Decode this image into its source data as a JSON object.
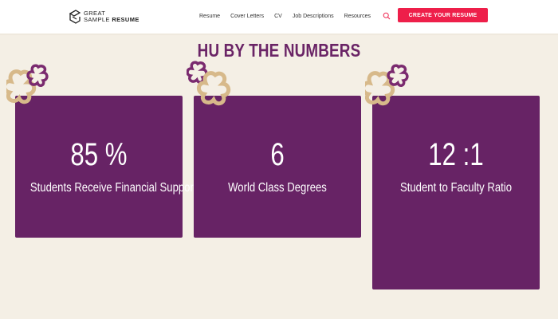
{
  "header": {
    "logo": {
      "line1": "GREAT",
      "line2_a": "SAMPLE ",
      "line2_b": "RESUME"
    },
    "nav": [
      "Resume",
      "Cover Letters",
      "CV",
      "Job Descriptions",
      "Resources"
    ],
    "search_icon": "search-icon",
    "cta_label": "CREATE YOUR RESUME"
  },
  "section": {
    "title": "HU BY THE NUMBERS"
  },
  "stats": [
    {
      "value": "85 %",
      "label": "Students Receive Financial Support"
    },
    {
      "value": "6",
      "label": "World Class Degrees"
    },
    {
      "value": "12 :1",
      "label": "Student to Faculty Ratio"
    }
  ],
  "colors": {
    "accent": "#ee1f4a",
    "purple": "#672365",
    "title_purple": "#6a2466",
    "gold": "#d7b98a",
    "background": "#f4efe5"
  }
}
